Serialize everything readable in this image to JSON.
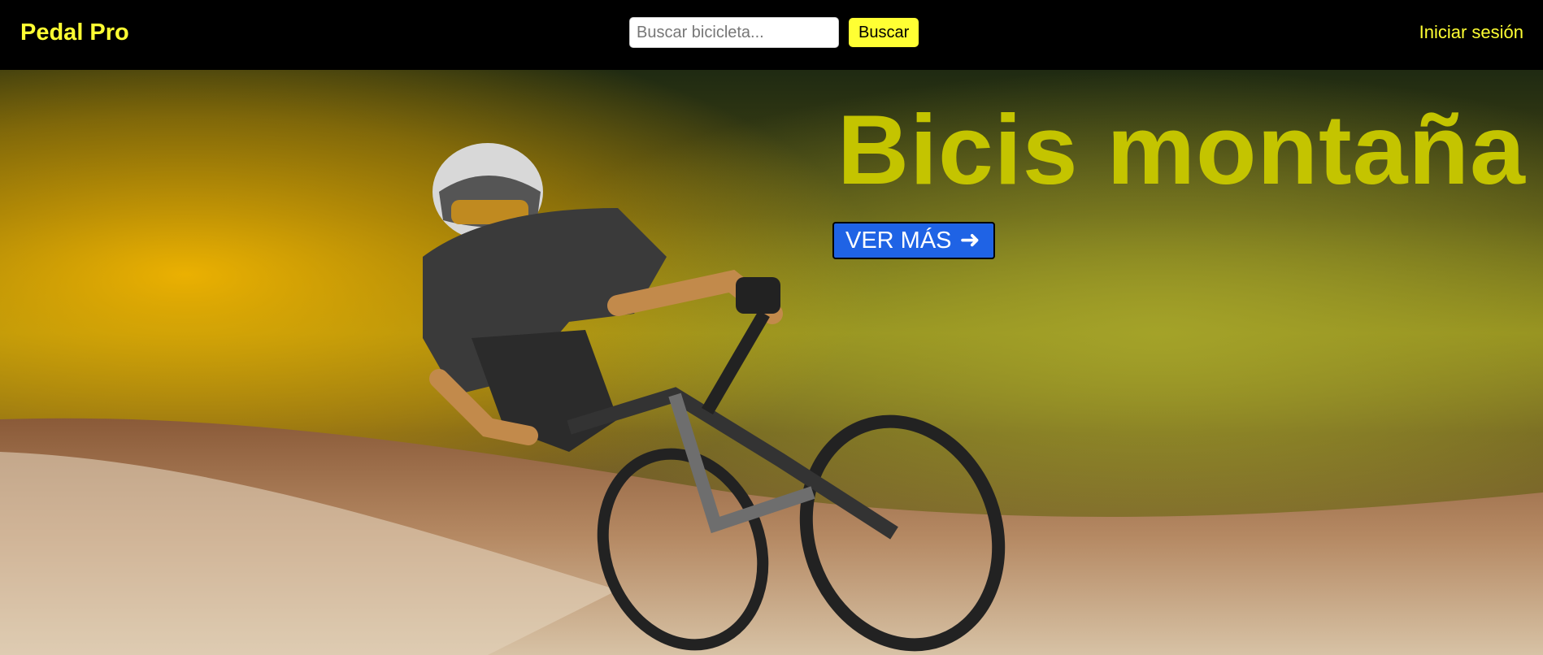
{
  "header": {
    "brand": "Pedal Pro",
    "search": {
      "placeholder": "Buscar bicicleta...",
      "value": "",
      "button_label": "Buscar"
    },
    "login_label": "Iniciar sesión"
  },
  "hero": {
    "title": "Bicis montaña",
    "cta_label": "VER MÁS",
    "cta_arrow": "➜",
    "image": "mountain-biker-on-dirt-trail"
  },
  "colors": {
    "accent": "#ffff33",
    "title": "#c4c400",
    "cta": "#1f63e5",
    "nav_bg": "#000000"
  }
}
